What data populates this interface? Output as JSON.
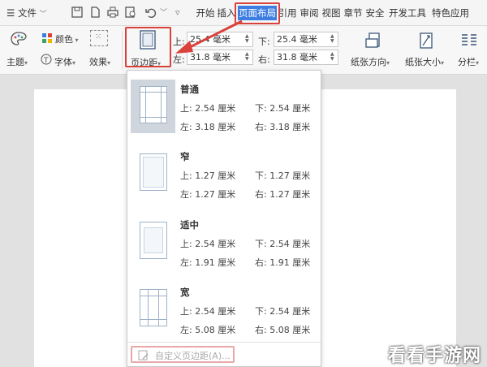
{
  "menubar": {
    "file_label": "文件",
    "tabs": [
      {
        "label": "开始"
      },
      {
        "label": "插入"
      },
      {
        "label": "页面布局"
      },
      {
        "label": "引用"
      },
      {
        "label": "审阅"
      },
      {
        "label": "视图"
      },
      {
        "label": "章节"
      },
      {
        "label": "安全"
      },
      {
        "label": "开发工具"
      },
      {
        "label": "特色应用"
      }
    ]
  },
  "ribbon": {
    "theme_label": "主题",
    "colors_label": "颜色",
    "font_label": "字体",
    "effects_label": "效果",
    "margins_label": "页边距",
    "top_label": "上:",
    "top_value": "25.4 毫米",
    "bottom_label": "下:",
    "bottom_value": "25.4 毫米",
    "left_label": "左:",
    "left_value": "31.8 毫米",
    "right_label": "右:",
    "right_value": "31.8 毫米",
    "orientation_label": "纸张方向",
    "size_label": "纸张大小",
    "columns_label": "分栏"
  },
  "margin_presets": [
    {
      "name": "普通",
      "top": "上: 2.54 厘米",
      "bottom": "下: 2.54 厘米",
      "left": "左: 3.18 厘米",
      "right": "右: 3.18 厘米"
    },
    {
      "name": "窄",
      "top": "上: 1.27 厘米",
      "bottom": "下: 1.27 厘米",
      "left": "左: 1.27 厘米",
      "right": "右: 1.27 厘米"
    },
    {
      "name": "适中",
      "top": "上: 2.54 厘米",
      "bottom": "下: 2.54 厘米",
      "left": "左: 1.91 厘米",
      "right": "右: 1.91 厘米"
    },
    {
      "name": "宽",
      "top": "上: 2.54 厘米",
      "bottom": "下: 2.54 厘米",
      "left": "左: 5.08 厘米",
      "right": "右: 5.08 厘米"
    }
  ],
  "custom_margins_label": "自定义页边距(A)...",
  "watermark": "看看手游网",
  "colors": {
    "accent": "#3b7de0",
    "highlight": "#d9413a"
  }
}
